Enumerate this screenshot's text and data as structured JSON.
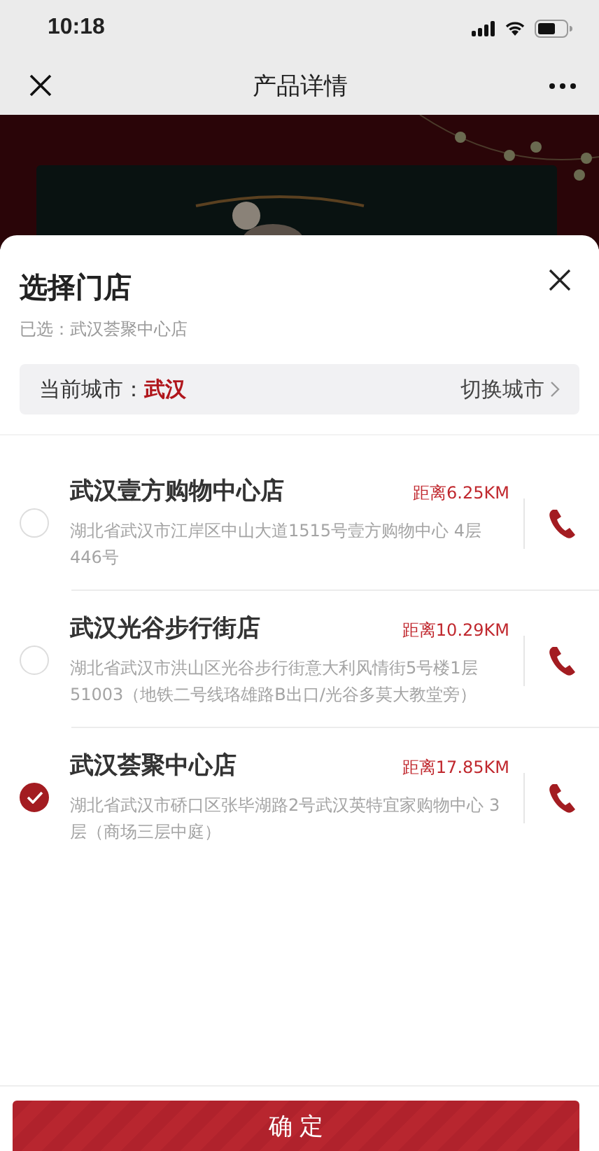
{
  "status_bar": {
    "time": "10:18"
  },
  "nav": {
    "title": "产品详情"
  },
  "sheet": {
    "title": "选择门店",
    "selected_text": "已选：武汉荟聚中心店",
    "city_label": "当前城市：",
    "city": "武汉",
    "switch_label": "切换城市"
  },
  "stores": [
    {
      "name": "武汉壹方购物中心店",
      "distance": "距离6.25KM",
      "address": "湖北省武汉市江岸区中山大道1515号壹方购物中心 4层446号",
      "selected": false
    },
    {
      "name": "武汉光谷步行街店",
      "distance": "距离10.29KM",
      "address": "湖北省武汉市洪山区光谷步行街意大利风情街5号楼1层51003（地铁二号线珞雄路B出口/光谷多莫大教堂旁）",
      "selected": false
    },
    {
      "name": "武汉荟聚中心店",
      "distance": "距离17.85KM",
      "address": "湖北省武汉市硚口区张毕湖路2号武汉英特宜家购物中心 3层（商场三层中庭）",
      "selected": true
    }
  ],
  "confirm_button": "确 定"
}
